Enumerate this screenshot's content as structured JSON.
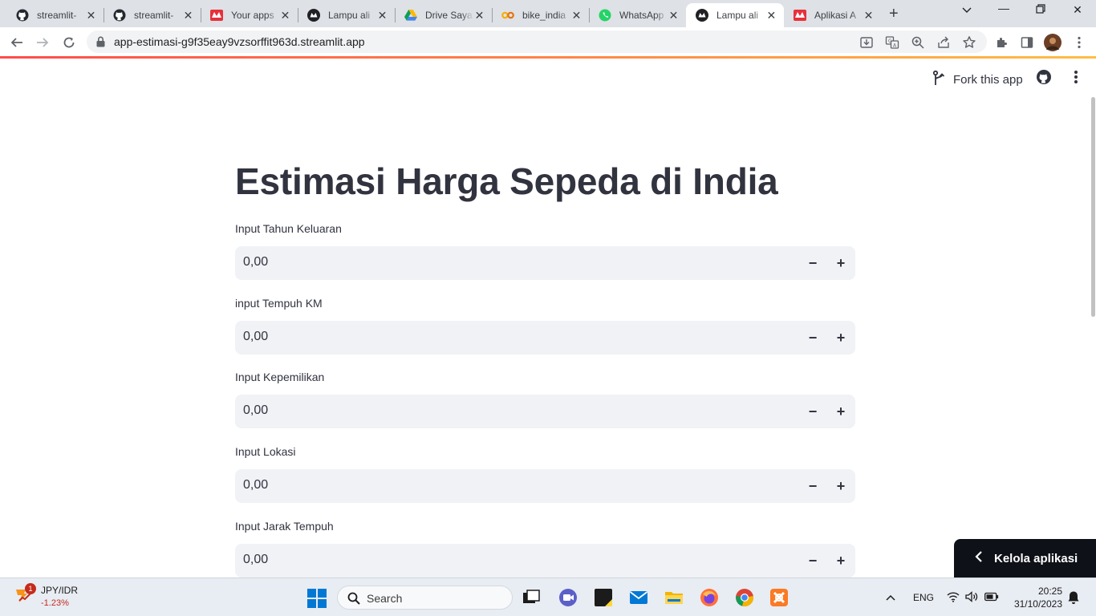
{
  "browser": {
    "tabs": [
      {
        "label": "streamlit-",
        "icon": "github-icon",
        "active": false
      },
      {
        "label": "streamlit-",
        "icon": "github-icon",
        "active": false
      },
      {
        "label": "Your apps",
        "icon": "streamlit-icon",
        "active": false
      },
      {
        "label": "Lampu ali",
        "icon": "streamlit-dark-icon",
        "active": false
      },
      {
        "label": "Drive Saya",
        "icon": "google-drive-icon",
        "active": false
      },
      {
        "label": "bike_india",
        "icon": "colab-icon",
        "active": false
      },
      {
        "label": "WhatsApp",
        "icon": "whatsapp-icon",
        "active": false
      },
      {
        "label": "Lampu ali",
        "icon": "streamlit-dark-icon",
        "active": true
      },
      {
        "label": "Aplikasi A",
        "icon": "streamlit-icon",
        "active": false
      }
    ],
    "url": "app-estimasi-g9f35eay9vzsorffit963d.streamlit.app"
  },
  "app": {
    "header": {
      "fork_label": "Fork this app"
    },
    "title": "Estimasi Harga Sepeda di India",
    "fields": [
      {
        "label": "Input Tahun Keluaran",
        "value": "0,00"
      },
      {
        "label": "input Tempuh KM",
        "value": "0,00"
      },
      {
        "label": "Input Kepemilikan",
        "value": "0,00"
      },
      {
        "label": "Input Lokasi",
        "value": "0,00"
      },
      {
        "label": "Input Jarak Tempuh",
        "value": "0,00"
      }
    ],
    "stepper": {
      "minus": "−",
      "plus": "+"
    },
    "manage_label": "Kelola aplikasi"
  },
  "taskbar": {
    "ticker": {
      "name": "JPY/IDR",
      "change": "-1.23%",
      "badge": "1"
    },
    "search_label": "Search",
    "language": "ENG",
    "time": "20:25",
    "date": "31/10/2023"
  },
  "colors": {
    "accent": "#ff4b4b",
    "input_bg": "#f0f2f6",
    "text": "#31333f",
    "dark_button": "#0e1117"
  }
}
